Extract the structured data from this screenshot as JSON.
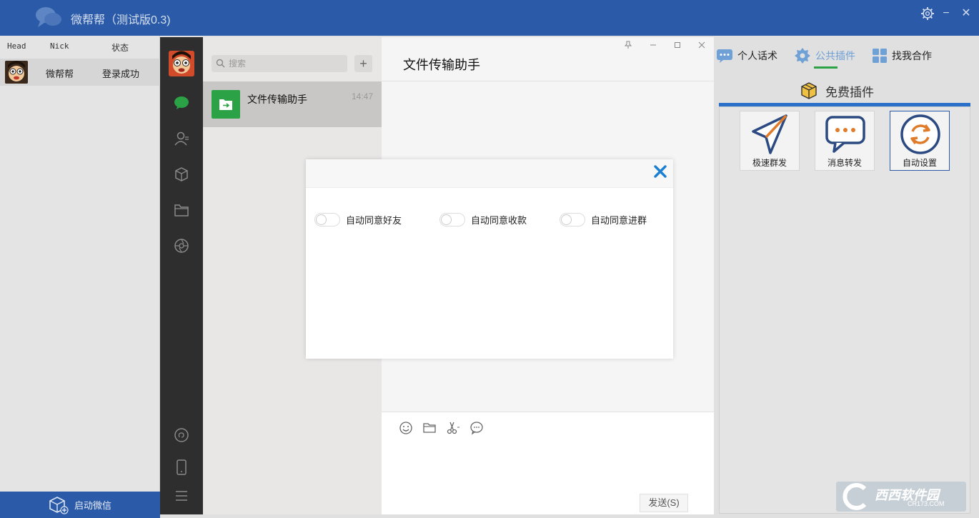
{
  "app": {
    "title": "微帮帮（测试版0.3)",
    "settings_icon": "gear-icon",
    "minimize_label": "−",
    "close_label": "✕"
  },
  "accounts": {
    "columns": [
      "Head",
      "Nick",
      "状态"
    ],
    "rows": [
      {
        "nick": "微帮帮",
        "status": "登录成功"
      }
    ],
    "start_button_label": "启动微信"
  },
  "wechat": {
    "search_placeholder": "搜索",
    "add_label": "+",
    "chat_list": [
      {
        "name": "文件传输助手",
        "time": "14:47"
      }
    ],
    "active_chat_title": "文件传输助手",
    "send_button_label": "发送(S)"
  },
  "plugins": {
    "tabs": [
      {
        "label": "个人话术",
        "active": false
      },
      {
        "label": "公共插件",
        "active": true
      },
      {
        "label": "找我合作",
        "active": false
      }
    ],
    "section_title": "免费插件",
    "cards": [
      {
        "label": "极速群发",
        "icon": "paper-plane-icon",
        "selected": false
      },
      {
        "label": "消息转发",
        "icon": "chat-bubble-icon",
        "selected": false
      },
      {
        "label": "自动设置",
        "icon": "refresh-icon",
        "selected": true
      }
    ]
  },
  "dialog": {
    "close_icon": "close-icon",
    "options": [
      {
        "label": "自动同意好友",
        "enabled": false
      },
      {
        "label": "自动同意收款",
        "enabled": false
      },
      {
        "label": "自动同意进群",
        "enabled": false
      }
    ]
  },
  "watermark": {
    "text": "西西软件园",
    "sub": "CR173.COM"
  },
  "colors": {
    "app_blue": "#2a5aa8",
    "wechat_green": "#2ba245",
    "dialog_close_blue": "#1a7fd4",
    "tab_active": "#6fa0d6"
  }
}
